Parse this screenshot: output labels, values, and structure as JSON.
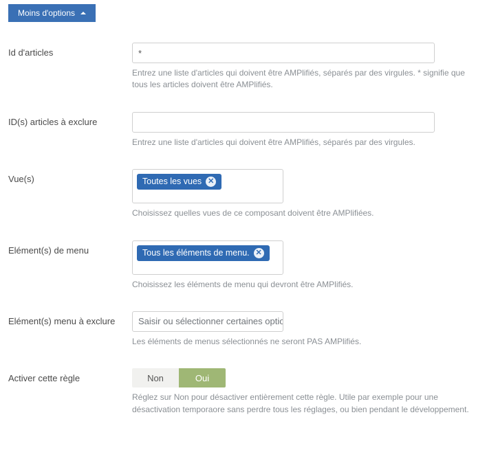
{
  "collapse_label": "Moins d'options",
  "fields": {
    "article_ids": {
      "label": "Id d'articles",
      "value": "*",
      "hint": "Entrez une liste d'articles qui doivent être AMPlifiés, séparés par des virgules. * signifie que tous les articles doivent être AMPlifiés."
    },
    "exclude_ids": {
      "label": "ID(s) articles à exclure",
      "value": "",
      "hint": "Entrez une liste d'articles qui doivent être AMPlifiés, séparés par des virgules."
    },
    "views": {
      "label": "Vue(s)",
      "tag": "Toutes les vues",
      "hint": "Choisissez quelles vues de ce composant doivent être AMPlifiées."
    },
    "menu_items": {
      "label": "Elément(s) de menu",
      "tag": "Tous les éléments de menu.",
      "hint": "Choisissez les éléments de menu qui devront être AMPlifiés."
    },
    "menu_exclude": {
      "label": "Elément(s) menu à exclure",
      "placeholder": "Saisir ou sélectionner certaines options",
      "hint": "Les éléments de menus sélectionnés ne seront PAS AMPlifiés."
    },
    "enable_rule": {
      "label": "Activer cette règle",
      "no": "Non",
      "yes": "Oui",
      "hint": "Réglez sur Non pour désactiver entièrement cette règle. Utile par exemple pour une désactivation temporaore sans perdre tous les réglages, ou bien pendant le développement."
    }
  }
}
